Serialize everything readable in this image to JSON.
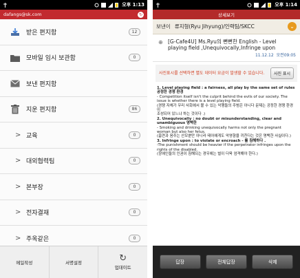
{
  "left": {
    "status": {
      "time": "오후 1:13"
    },
    "account": {
      "email": "dafangs@sk.com"
    },
    "folders": [
      {
        "label": "받은 편지함",
        "count": "12",
        "icon": "inbox-icon"
      },
      {
        "label": "모바일 임시 보관함",
        "count": "0",
        "icon": "folder-icon"
      },
      {
        "label": "보낸 편지함",
        "count": "",
        "icon": "envelope-icon"
      },
      {
        "label": "지운 편지함",
        "count": "86",
        "icon": "trash-icon"
      },
      {
        "label": "교육",
        "count": "0",
        "icon": "chevron-right-icon"
      },
      {
        "label": "대외협력팀",
        "count": "0",
        "icon": "chevron-right-icon"
      },
      {
        "label": "본부장",
        "count": "0",
        "icon": "chevron-right-icon"
      },
      {
        "label": "전자결재",
        "count": "0",
        "icon": "chevron-right-icon"
      },
      {
        "label": "주옥같은",
        "count": "0",
        "icon": "chevron-right-icon"
      }
    ],
    "bottom": {
      "compose": "메일작성",
      "signature": "서명설정",
      "update": "업데이트"
    }
  },
  "right": {
    "status": {
      "time": "오후 1:14"
    },
    "title": "상세보기",
    "sender_label": "보낸이",
    "sender": "류지형(Ryu Jihyung)/인력팀/SKCC",
    "subject": "[G-Cafe4U] Ms.Ryu의 뻔뻔한 English - Level playing field ,Unequivocally,Infringe upon",
    "date": "11.12.12",
    "time": "오전09:05",
    "notice": "사진표시를 선택하면 별도 데이터 요금이 발생할 수 있습니다.",
    "notice_button": "사진 표시",
    "body": [
      "1. Level playing field : a fairness, all play by the same set of rules 공정한 경쟁 환경",
      "- Competition itself isn't the culprit behind the evils of our society. The issue is whether there is a level playing field.",
      "(경쟁 자체가 우리 사회에서 볼 수 있는 악행들의 주범은 아니다 문제는 공정한 경쟁 환경이",
      "조성되어 있느냐 하는 것이다 .)",
      "2. Unequivocally : no doubt or misunderstanding, clear and unambiguous 명백한",
      "- Smoking and drinking unequivocally harms not only the pregnant woman but also her fetus.",
      "(흡연과 음주는 산모뿐만 아니라 태아에게도 악영향을 끼친다는 것은 명백한 사실이다.)",
      "3. Infringe upon : to violate or encroach - 를 침해하다 .",
      "-The punishment should be heavier if the perpetrator infringes upon the rights of the disabled.",
      "(장애인들의 인권이 침해되는 경우에는 벌이 더욱 엄격해야 한다.)"
    ],
    "buttons": {
      "reply": "답장",
      "reply_all": "전체답장",
      "delete": "삭제"
    }
  }
}
